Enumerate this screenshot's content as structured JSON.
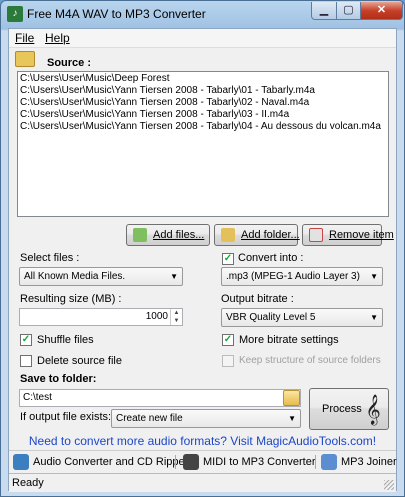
{
  "window": {
    "title": "Free M4A WAV to MP3 Converter"
  },
  "menu": {
    "file": "File",
    "help": "Help"
  },
  "source": {
    "label": "Source :",
    "files": [
      "C:\\Users\\User\\Music\\Deep Forest",
      "C:\\Users\\User\\Music\\Yann Tiersen 2008 - Tabarly\\01 - Tabarly.m4a",
      "C:\\Users\\User\\Music\\Yann Tiersen 2008 - Tabarly\\02 - Naval.m4a",
      "C:\\Users\\User\\Music\\Yann Tiersen 2008 - Tabarly\\03 - II.m4a",
      "C:\\Users\\User\\Music\\Yann Tiersen 2008 - Tabarly\\04 - Au dessous du volcan.m4a"
    ]
  },
  "buttons": {
    "add_files": "Add files...",
    "add_folder": "Add folder...",
    "remove_item": "Remove item",
    "process": "Process"
  },
  "options": {
    "select_files_label": "Select files :",
    "select_files_value": "All Known Media Files.",
    "convert_into_label": "Convert into :",
    "convert_into_checked": true,
    "convert_into_value": ".mp3 (MPEG-1 Audio Layer 3)",
    "resulting_size_label": "Resulting size (MB) :",
    "resulting_size_value": "1000",
    "output_bitrate_label": "Output bitrate :",
    "output_bitrate_value": "VBR Quality Level 5",
    "shuffle_files_label": "Shuffle files",
    "shuffle_files_checked": true,
    "more_bitrate_label": "More bitrate settings",
    "more_bitrate_checked": true,
    "delete_source_label": "Delete source file",
    "delete_source_checked": false,
    "keep_structure_label": "Keep structure of source folders",
    "keep_structure_checked": false,
    "save_to_folder_label": "Save to folder:",
    "save_to_folder_value": "C:\\test",
    "if_exists_label": "If output file exists:",
    "if_exists_value": "Create new file"
  },
  "promo": "Need to convert more audio formats? Visit MagicAudioTools.com!",
  "links": {
    "audio_converter": "Audio Converter and CD Ripper",
    "midi_to_mp3": "MIDI to MP3 Converter",
    "mp3_joiner": "MP3  Joiner"
  },
  "status": "Ready",
  "colors": {
    "promo": "#1c46c8",
    "titlebar": "#b9d5ee",
    "close": "#c6412a"
  }
}
